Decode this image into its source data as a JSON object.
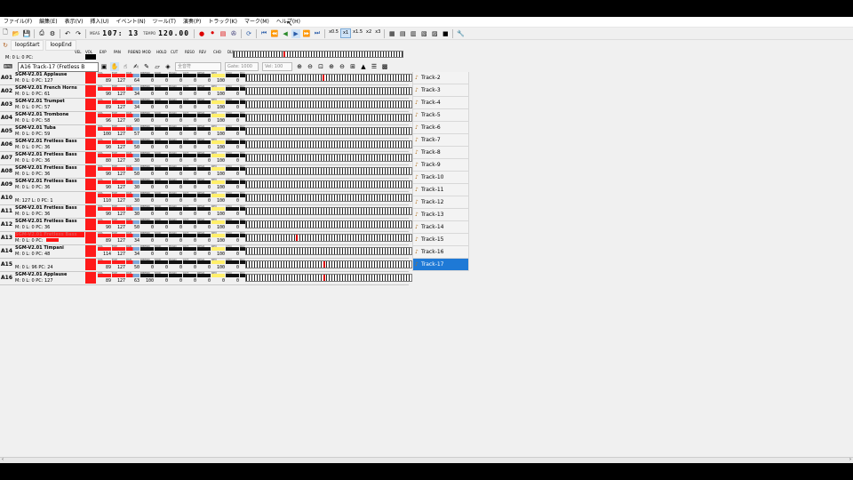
{
  "menu": [
    "ファイル(F)",
    "編集(E)",
    "表示(V)",
    "挿入(U)",
    "イベント(N)",
    "ツール(T)",
    "演奏(P)",
    "トラック(K)",
    "マーク(M)",
    "ヘルプ(H)"
  ],
  "toolbar": {
    "measure_label": "MEAS",
    "measure": "107:",
    "beat": "13",
    "tempo_label": "TEMPO",
    "tempo": "120.00",
    "speeds": [
      "x0.5",
      "x1",
      "x1.5",
      "x2",
      "x3"
    ],
    "selected_speed": "x1"
  },
  "toolbar2": {
    "loop_start": "loopStart",
    "loop_end": "loopEnd"
  },
  "control_headers": [
    "VEL",
    "VOL",
    "EXP",
    "PAN",
    "P.BEND",
    "MOD",
    "HOLD",
    "CUT",
    "RESO",
    "REV",
    "CHO",
    "DLY"
  ],
  "master": {
    "info": "M:  0  L:  0 PC:"
  },
  "control_row": {
    "selected_track": "A16 Track-17 (Fretless B",
    "channel": "全音符",
    "gate": "Gate: 1000",
    "vel": "Vel: 100"
  },
  "tracks": [
    {
      "id": "A01",
      "name": "SGM-V2.01 Applause",
      "m": "0",
      "l": "0",
      "pc": "127",
      "values": [
        "89",
        "127",
        "64",
        "0",
        "0",
        "0",
        "0",
        "0",
        "100",
        "0",
        "0"
      ],
      "note": 0.46
    },
    {
      "id": "A02",
      "name": "SGM-V2.01 French Horns",
      "m": "0",
      "l": "0",
      "pc": "61",
      "values": [
        "90",
        "127",
        "34",
        "0",
        "0",
        "0",
        "0",
        "0",
        "100",
        "0",
        "0"
      ],
      "note": -1
    },
    {
      "id": "A03",
      "name": "SGM-V2.01 Trumpet",
      "m": "0",
      "l": "0",
      "pc": "57",
      "values": [
        "89",
        "127",
        "34",
        "0",
        "0",
        "0",
        "0",
        "0",
        "100",
        "0",
        "0"
      ],
      "note": -1
    },
    {
      "id": "A04",
      "name": "SGM-V2.01 Trombone",
      "m": "0",
      "l": "0",
      "pc": "58",
      "values": [
        "96",
        "127",
        "90",
        "0",
        "0",
        "0",
        "0",
        "0",
        "100",
        "0",
        "0"
      ],
      "note": -1
    },
    {
      "id": "A05",
      "name": "SGM-V2.01 Tuba",
      "m": "0",
      "l": "0",
      "pc": "59",
      "values": [
        "100",
        "127",
        "57",
        "0",
        "0",
        "0",
        "0",
        "0",
        "100",
        "0",
        "20"
      ],
      "note": -1
    },
    {
      "id": "A06",
      "name": "SGM-V2.01 Fretless Bass",
      "m": "0",
      "l": "0",
      "pc": "36",
      "values": [
        "90",
        "127",
        "50",
        "0",
        "0",
        "0",
        "0",
        "0",
        "100",
        "0",
        "0"
      ],
      "note": -1
    },
    {
      "id": "A07",
      "name": "SGM-V2.01 Fretless Bass",
      "m": "0",
      "l": "0",
      "pc": "36",
      "values": [
        "80",
        "127",
        "30",
        "0",
        "0",
        "0",
        "0",
        "0",
        "100",
        "0",
        "0"
      ],
      "note": -1
    },
    {
      "id": "A08",
      "name": "SGM-V2.01 Fretless Bass",
      "m": "0",
      "l": "0",
      "pc": "36",
      "values": [
        "90",
        "127",
        "50",
        "0",
        "0",
        "0",
        "0",
        "0",
        "100",
        "0",
        "0"
      ],
      "note": -1
    },
    {
      "id": "A09",
      "name": "SGM-V2.01 Fretless Bass",
      "m": "0",
      "l": "0",
      "pc": "36",
      "values": [
        "90",
        "127",
        "30",
        "0",
        "0",
        "0",
        "0",
        "0",
        "100",
        "0",
        "0"
      ],
      "note": -1
    },
    {
      "id": "A10",
      "name": "",
      "m": "127",
      "l": "0",
      "pc": "1",
      "values": [
        "110",
        "127",
        "30",
        "0",
        "0",
        "0",
        "0",
        "0",
        "100",
        "0",
        "0"
      ],
      "note": -1
    },
    {
      "id": "A11",
      "name": "SGM-V2.01 Fretless Bass",
      "m": "0",
      "l": "0",
      "pc": "36",
      "values": [
        "90",
        "127",
        "30",
        "0",
        "0",
        "0",
        "0",
        "0",
        "100",
        "0",
        "0"
      ],
      "note": -1
    },
    {
      "id": "A12",
      "name": "SGM-V2.01 Fretless Bass",
      "m": "0",
      "l": "0",
      "pc": "36",
      "values": [
        "90",
        "127",
        "50",
        "0",
        "0",
        "0",
        "0",
        "0",
        "100",
        "0",
        "0"
      ],
      "note": -1
    },
    {
      "id": "A13",
      "name": "SGM-V2.01 Fretless Bass",
      "m": "0",
      "l": "0",
      "pc": "",
      "values": [
        "89",
        "127",
        "34",
        "0",
        "0",
        "0",
        "0",
        "0",
        "100",
        "0",
        "15"
      ],
      "note": 0.3,
      "highlight": true
    },
    {
      "id": "A14",
      "name": "SGM-V2.01 Timpani",
      "m": "0",
      "l": "0",
      "pc": "48",
      "values": [
        "114",
        "127",
        "34",
        "0",
        "0",
        "0",
        "0",
        "0",
        "100",
        "0",
        "0"
      ],
      "note": -1
    },
    {
      "id": "A15",
      "name": "",
      "m": "0",
      "l": "96",
      "pc": "24",
      "values": [
        "89",
        "127",
        "50",
        "0",
        "0",
        "0",
        "0",
        "0",
        "100",
        "0",
        "0"
      ],
      "note": 0.47
    },
    {
      "id": "A16",
      "name": "SGM-V2.01 Applause",
      "m": "0",
      "l": "0",
      "pc": "127",
      "values": [
        "89",
        "127",
        "63",
        "100",
        "0",
        "0",
        "0",
        "0",
        "0",
        "0",
        "0"
      ],
      "note": 0.47
    }
  ],
  "track_list": [
    "Track-2",
    "Track-3",
    "Track-4",
    "Track-5",
    "Track-6",
    "Track-7",
    "Track-8",
    "Track-9",
    "Track-10",
    "Track-11",
    "Track-12",
    "Track-13",
    "Track-14",
    "Track-15",
    "Track-16",
    "Track-17"
  ],
  "selected_track_list_item": "Track-17"
}
